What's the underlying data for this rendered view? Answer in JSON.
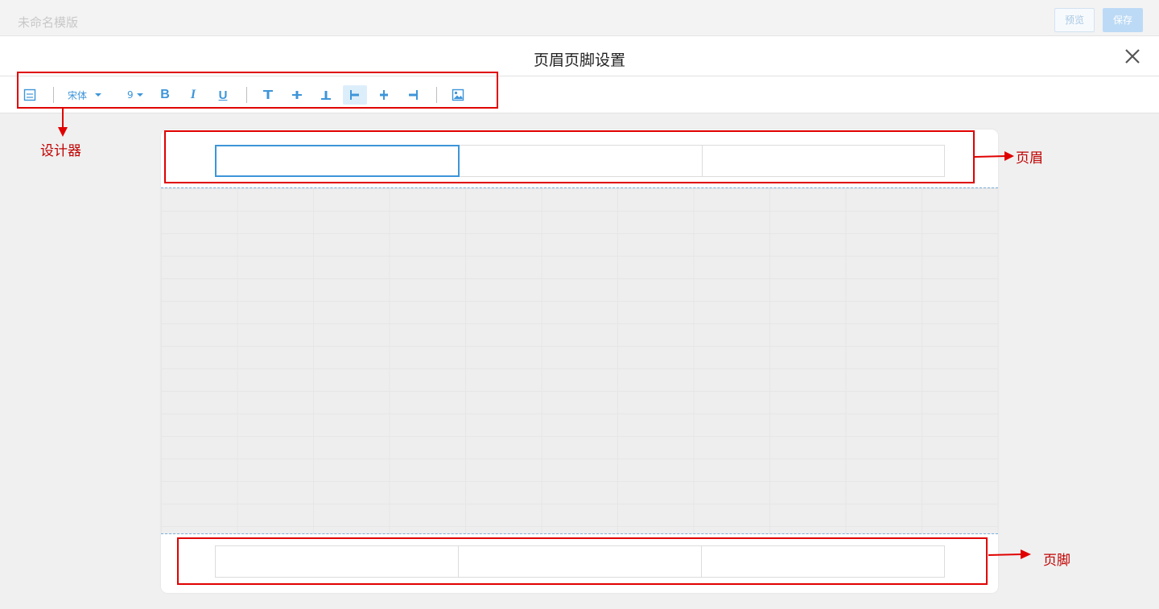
{
  "app": {
    "title": "未命名模版",
    "preview_label": "预览",
    "save_label": "保存"
  },
  "dialog": {
    "title": "页眉页脚设置",
    "close_icon": "close-icon"
  },
  "toolbar": {
    "items": [
      {
        "name": "page-setting-icon"
      },
      {
        "name": "font-family-select",
        "value": "宋体"
      },
      {
        "name": "font-size-select",
        "value": "9"
      },
      {
        "name": "bold-button",
        "label": "B"
      },
      {
        "name": "italic-button",
        "label": "I"
      },
      {
        "name": "underline-button",
        "label": "U"
      },
      {
        "name": "align-top-icon"
      },
      {
        "name": "align-middle-icon"
      },
      {
        "name": "align-bottom-icon"
      },
      {
        "name": "align-left-icon",
        "active": true
      },
      {
        "name": "align-center-icon"
      },
      {
        "name": "align-right-icon"
      },
      {
        "name": "image-icon"
      }
    ]
  },
  "header_cells": [
    "",
    "",
    ""
  ],
  "footer_cells": [
    "",
    "",
    ""
  ],
  "annotations": {
    "designer": "设计器",
    "header": "页眉",
    "footer": "页脚",
    "color": "#e00000"
  },
  "colors": {
    "accent": "#3d95d9",
    "annotation": "#e00000"
  }
}
